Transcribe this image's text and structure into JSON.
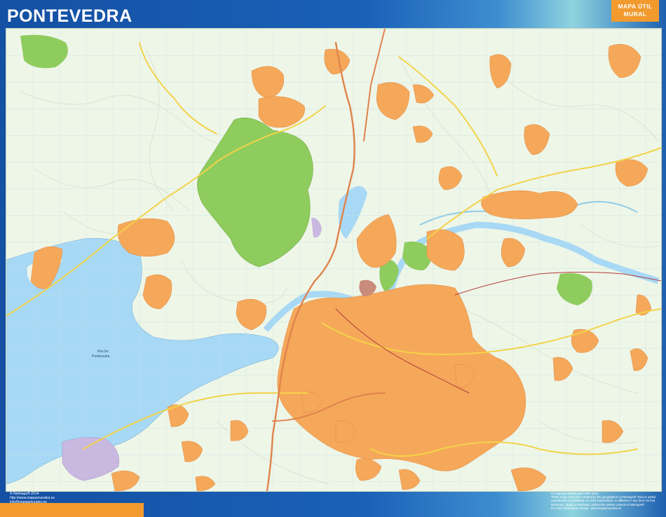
{
  "header": {
    "title": "PONTEVEDRA",
    "badge_line1": "MAPA ÚTIL",
    "badge_line2": "MURAL"
  },
  "map": {
    "sea_label_line1": "Ría De",
    "sea_label_line2": "Pontevedra",
    "colors": {
      "background": "#eef6e8",
      "urban": "#f5a85a",
      "park": "#8fcc5e",
      "water": "#a7d8f5",
      "road_major": "#f3d34a",
      "road_motorway": "#e0834c",
      "industrial": "#c9b8e0",
      "grid": "#bfe2e6"
    }
  },
  "footer": {
    "left_line1": "© Netmaps® 2014",
    "left_line2": "http://www.mapasmurales.es",
    "left_line3": "info@mapasmurales.es",
    "right_line1": "© Copyright ©Netmaps® 1997-2014",
    "right_line2": "These maps have been created by the geographers at Netmaps®.Total or partial",
    "right_line3": "reproduction is prohibited; as is the transmission or diffusion in any form, be that",
    "right_line4": "electronic, digital or mechanic; without the written consent of Netmaps®.",
    "right_line5": "For more information consult : www.mapasmurales.es"
  }
}
